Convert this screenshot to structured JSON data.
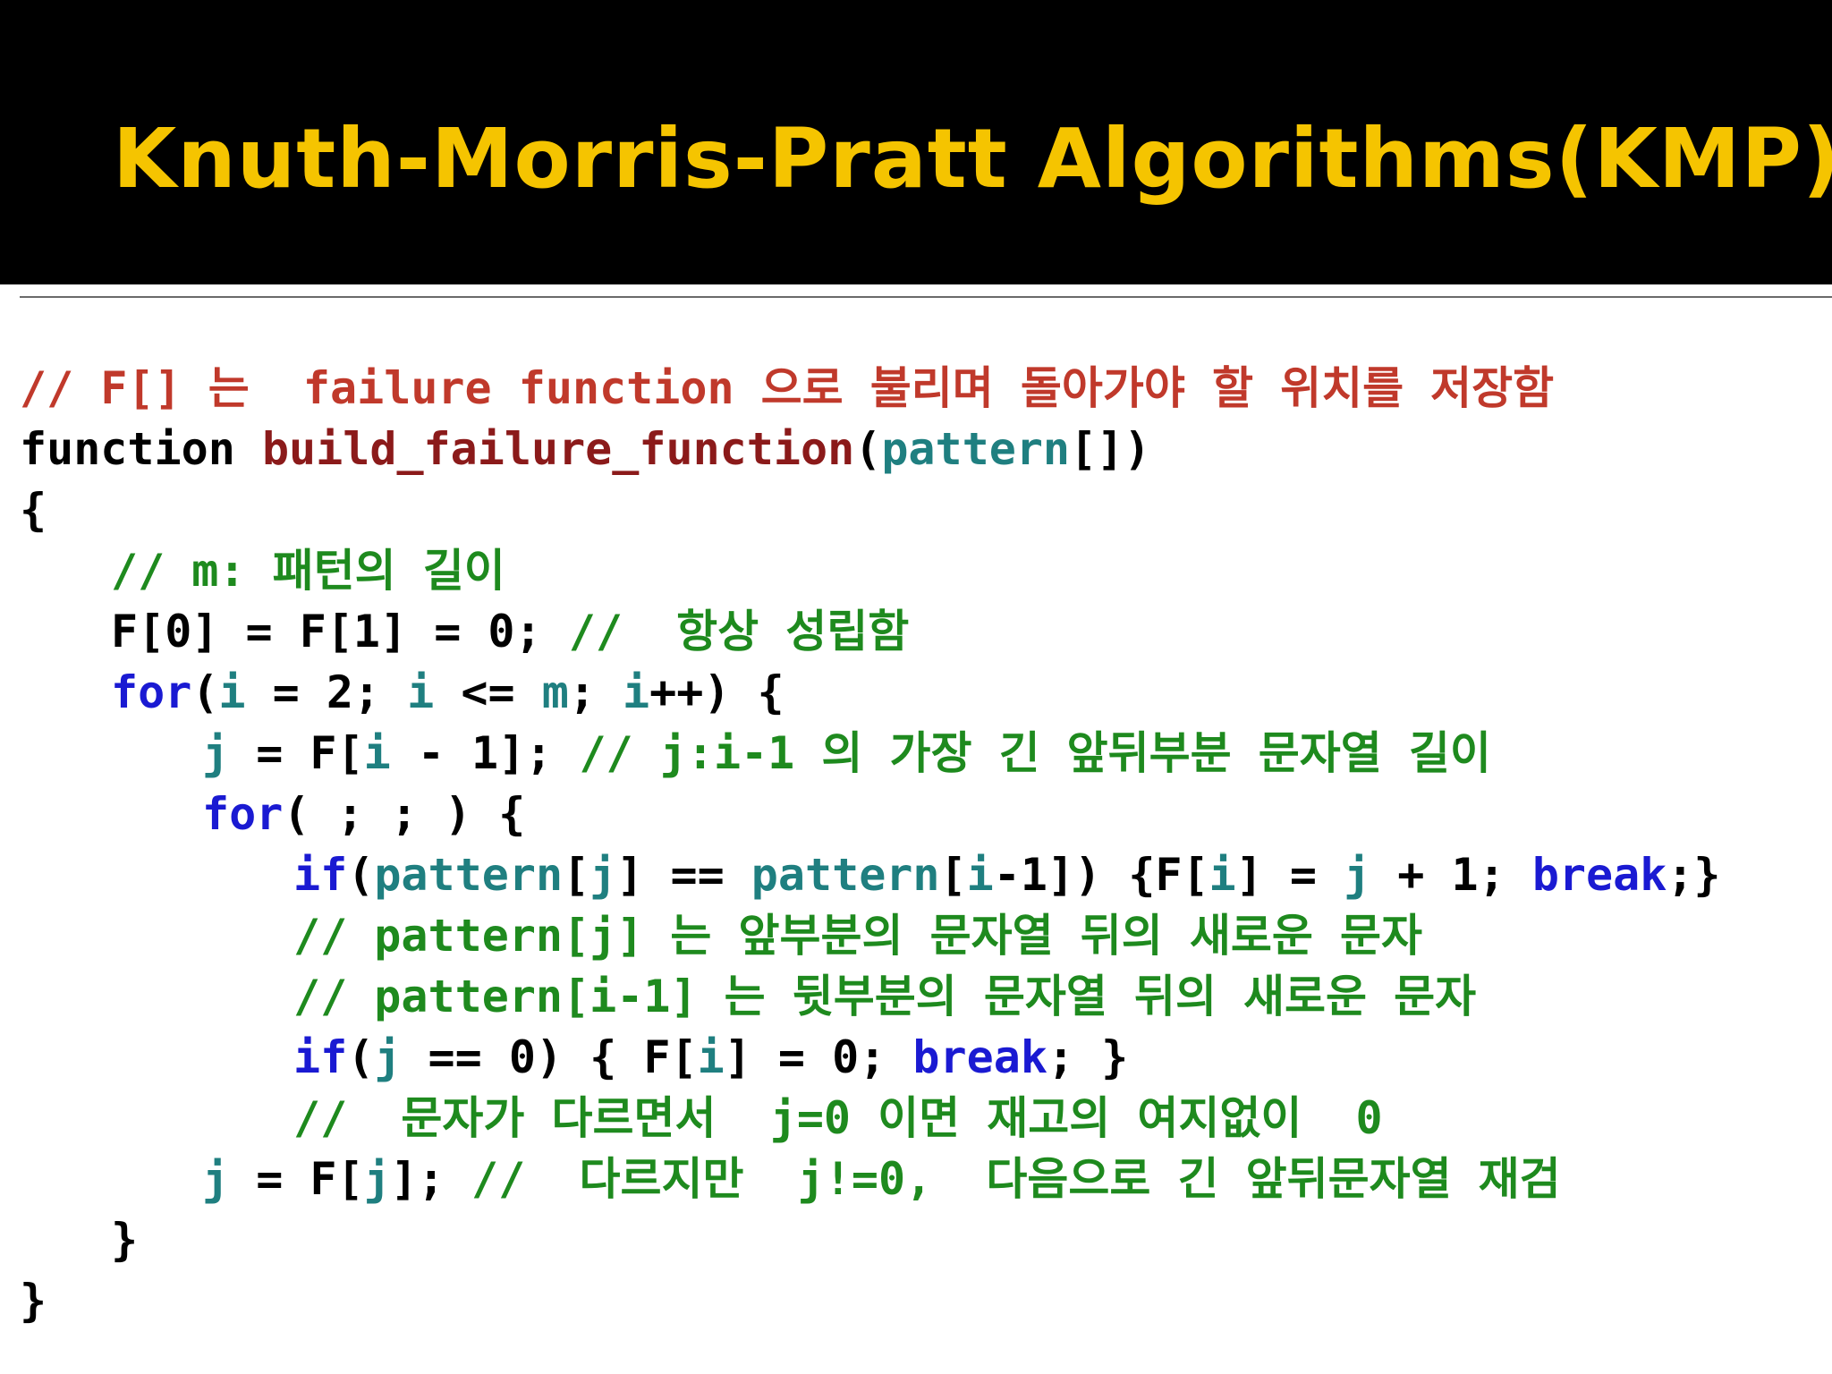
{
  "slide": {
    "title": "Knuth-Morris-Pratt Algorithms(KMP)"
  },
  "colors": {
    "title_bar_background": "#000000",
    "title_text": "#f5c400",
    "keyword": "#1a1ad2",
    "function_name": "#8b1a1a",
    "variable": "#1f7f80",
    "comment_header": "#c0392b",
    "comment_body": "#1e8a1e",
    "plain_text": "#000000"
  },
  "code": {
    "lines": [
      {
        "indent": 0,
        "tokens": [
          {
            "t": "cmt-red",
            "text": "// F[] 는  failure function 으로 불리며 돌아가야 할 위치를 저장함"
          }
        ]
      },
      {
        "indent": 0,
        "tokens": [
          {
            "t": "plain",
            "text": "function "
          },
          {
            "t": "fn",
            "text": "build_failure_function"
          },
          {
            "t": "plain",
            "text": "("
          },
          {
            "t": "var",
            "text": "pattern"
          },
          {
            "t": "plain",
            "text": "[])"
          }
        ]
      },
      {
        "indent": 0,
        "tokens": [
          {
            "t": "plain",
            "text": "{"
          }
        ]
      },
      {
        "indent": 1,
        "tokens": [
          {
            "t": "cmt-grn",
            "text": "// m: 패턴의 길이"
          }
        ]
      },
      {
        "indent": 1,
        "tokens": [
          {
            "t": "plain",
            "text": "F[0] = F[1] = 0; "
          },
          {
            "t": "cmt-grn",
            "text": "//  항상 성립함"
          }
        ]
      },
      {
        "indent": 1,
        "tokens": [
          {
            "t": "kw",
            "text": "for"
          },
          {
            "t": "plain",
            "text": "("
          },
          {
            "t": "var",
            "text": "i"
          },
          {
            "t": "plain",
            "text": " = 2; "
          },
          {
            "t": "var",
            "text": "i"
          },
          {
            "t": "plain",
            "text": " <= "
          },
          {
            "t": "var",
            "text": "m"
          },
          {
            "t": "plain",
            "text": "; "
          },
          {
            "t": "var",
            "text": "i"
          },
          {
            "t": "plain",
            "text": "++) {"
          }
        ]
      },
      {
        "indent": 2,
        "tokens": [
          {
            "t": "var",
            "text": "j"
          },
          {
            "t": "plain",
            "text": " = F["
          },
          {
            "t": "var",
            "text": "i"
          },
          {
            "t": "plain",
            "text": " - 1]; "
          },
          {
            "t": "cmt-grn",
            "text": "// j:i-1 의 가장 긴 앞뒤부분 문자열 길이"
          }
        ]
      },
      {
        "indent": 2,
        "tokens": [
          {
            "t": "kw",
            "text": "for"
          },
          {
            "t": "plain",
            "text": "( ; ; ) {"
          }
        ]
      },
      {
        "indent": 3,
        "tokens": [
          {
            "t": "kw",
            "text": "if"
          },
          {
            "t": "plain",
            "text": "("
          },
          {
            "t": "var",
            "text": "pattern"
          },
          {
            "t": "plain",
            "text": "["
          },
          {
            "t": "var",
            "text": "j"
          },
          {
            "t": "plain",
            "text": "] == "
          },
          {
            "t": "var",
            "text": "pattern"
          },
          {
            "t": "plain",
            "text": "["
          },
          {
            "t": "var",
            "text": "i"
          },
          {
            "t": "plain",
            "text": "-1]) {F["
          },
          {
            "t": "var",
            "text": "i"
          },
          {
            "t": "plain",
            "text": "] = "
          },
          {
            "t": "var",
            "text": "j"
          },
          {
            "t": "plain",
            "text": " + 1; "
          },
          {
            "t": "kw",
            "text": "break"
          },
          {
            "t": "plain",
            "text": ";}"
          }
        ]
      },
      {
        "indent": 3,
        "tokens": [
          {
            "t": "cmt-grn",
            "text": "// pattern[j] 는 앞부분의 문자열 뒤의 새로운 문자"
          }
        ]
      },
      {
        "indent": 3,
        "tokens": [
          {
            "t": "cmt-grn",
            "text": "// pattern[i-1] 는 뒷부분의 문자열 뒤의 새로운 문자"
          }
        ]
      },
      {
        "indent": 3,
        "tokens": [
          {
            "t": "kw",
            "text": "if"
          },
          {
            "t": "plain",
            "text": "("
          },
          {
            "t": "var",
            "text": "j"
          },
          {
            "t": "plain",
            "text": " == 0) { F["
          },
          {
            "t": "var",
            "text": "i"
          },
          {
            "t": "plain",
            "text": "] = 0; "
          },
          {
            "t": "kw",
            "text": "break"
          },
          {
            "t": "plain",
            "text": "; }"
          }
        ]
      },
      {
        "indent": 3,
        "tokens": [
          {
            "t": "cmt-grn",
            "text": "//  문자가 다르면서  j=0 이면 재고의 여지없이  0"
          }
        ]
      },
      {
        "indent": 2,
        "tokens": [
          {
            "t": "var",
            "text": "j"
          },
          {
            "t": "plain",
            "text": " = F["
          },
          {
            "t": "var",
            "text": "j"
          },
          {
            "t": "plain",
            "text": "]; "
          },
          {
            "t": "cmt-grn",
            "text": "//  다르지만  j!=0,  다음으로 긴 앞뒤문자열 재검"
          }
        ]
      },
      {
        "indent": 1,
        "tokens": [
          {
            "t": "plain",
            "text": "}"
          }
        ]
      },
      {
        "indent": 0,
        "tokens": [
          {
            "t": "plain",
            "text": "}"
          }
        ]
      }
    ]
  }
}
